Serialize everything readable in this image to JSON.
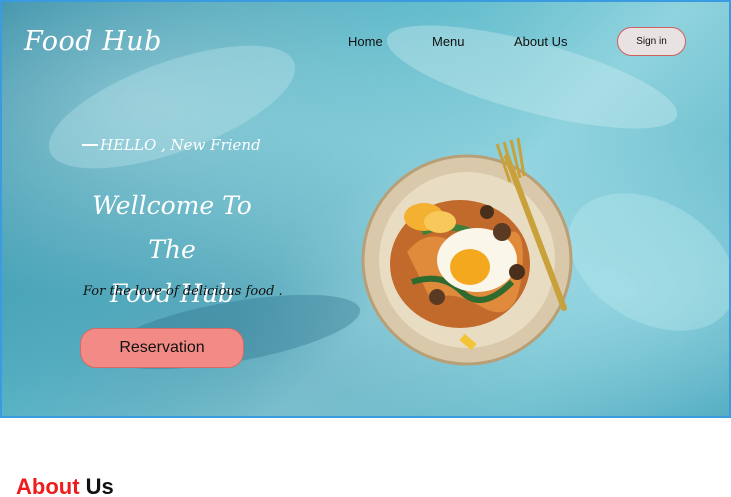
{
  "header": {
    "logo": "Food Hub",
    "nav": [
      "Home",
      "Menu",
      "About Us"
    ],
    "sign_in_label": "Sign in"
  },
  "hero": {
    "greeting": "HELLO , New Friend",
    "welcome_line1": "Wellcome To The",
    "welcome_line2": "Food Hub",
    "tagline": "For the love of delicious food .",
    "reservation_label": "Reservation"
  },
  "about": {
    "heading_part1": "About",
    "heading_part2": "Us"
  },
  "colors": {
    "accent_red": "#ee1c1c",
    "button_pink": "#f28b86",
    "hero_blue": "#5ab7c8"
  }
}
